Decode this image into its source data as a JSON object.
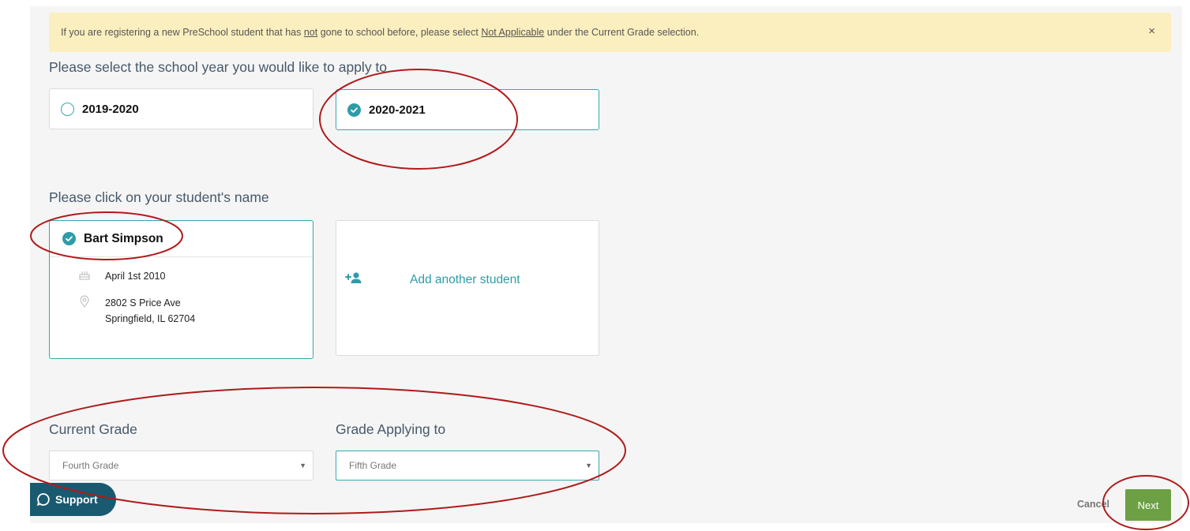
{
  "alert": {
    "text_before": "If you are registering a new PreSchool student that has ",
    "emph1": "not",
    "text_middle": " gone to school before, please select ",
    "emph2": "Not Applicable",
    "text_after": " under the Current Grade selection.",
    "close": "×"
  },
  "school_year": {
    "prompt": "Please select the school year you would like to apply to",
    "options": [
      {
        "label": "2019-2020",
        "selected": false
      },
      {
        "label": "2020-2021",
        "selected": true
      }
    ]
  },
  "students": {
    "prompt": "Please click on your student's name",
    "student": {
      "name": "Bart Simpson",
      "birthday": "April 1st 2010",
      "address_line1": "2802 S Price Ave",
      "address_line2": "Springfield, IL 62704"
    },
    "add_label": "Add another student"
  },
  "grades": {
    "current_label": "Current Grade",
    "current_value": "Fourth Grade",
    "applying_label": "Grade Applying to",
    "applying_value": "Fifth Grade"
  },
  "footer": {
    "support_label": "Support",
    "cancel_label": "Cancel",
    "next_label": "Next"
  },
  "colors": {
    "accent": "#2e9ca8",
    "next_button": "#6da044",
    "support_button": "#1a5a70",
    "alert_bg": "#fcefbf",
    "annotation": "#b01a1a"
  }
}
